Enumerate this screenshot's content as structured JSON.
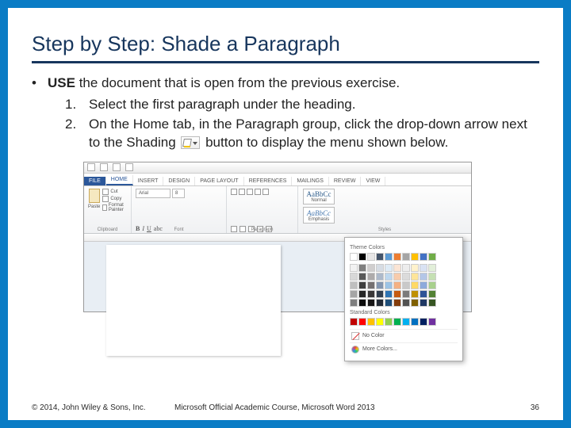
{
  "title": "Step by Step: Shade a Paragraph",
  "bullet": {
    "use_label": "USE",
    "use_rest": " the document that is open from the previous exercise.",
    "steps": [
      {
        "num": "1.",
        "text": "Select the first paragraph under the heading."
      },
      {
        "num": "2.",
        "text_a": "On the Home tab, in the Paragraph group, click the drop-down arrow next to the Shading ",
        "text_b": " button to display the menu shown below."
      }
    ]
  },
  "ribbon": {
    "tabs": {
      "file": "FILE",
      "home": "HOME",
      "insert": "INSERT",
      "design": "DESIGN",
      "pagelayout": "PAGE LAYOUT",
      "references": "REFERENCES",
      "mailings": "MAILINGS",
      "review": "REVIEW",
      "view": "VIEW"
    },
    "clipboard": {
      "paste": "Paste",
      "cut": "Cut",
      "copy": "Copy",
      "painter": "Format Painter",
      "label": "Clipboard"
    },
    "font": {
      "name": "Arial",
      "size": "8",
      "label": "Font"
    },
    "paragraph": {
      "label": "Paragraph"
    },
    "styles": {
      "normal_prev": "AaBbCc",
      "normal": "Normal",
      "emph_prev": "AaBbCc",
      "emph": "Emphasis",
      "label": "Styles"
    }
  },
  "dropdown": {
    "theme_label": "Theme Colors",
    "theme_top": [
      "#ffffff",
      "#000000",
      "#e7e6e6",
      "#44546a",
      "#5b9bd5",
      "#ed7d31",
      "#a5a5a5",
      "#ffc000",
      "#4472c4",
      "#70ad47"
    ],
    "theme_shades": [
      [
        "#f2f2f2",
        "#7f7f7f",
        "#d0cece",
        "#d6dce4",
        "#deebf6",
        "#fbe5d5",
        "#ededed",
        "#fff2cc",
        "#d9e2f3",
        "#e2efd9"
      ],
      [
        "#d8d8d8",
        "#595959",
        "#aeabab",
        "#adb9ca",
        "#bdd7ee",
        "#f7cbac",
        "#dbdbdb",
        "#fee599",
        "#b4c6e7",
        "#c5e0b3"
      ],
      [
        "#bfbfbf",
        "#3f3f3f",
        "#757070",
        "#8496b0",
        "#9cc3e5",
        "#f4b183",
        "#c9c9c9",
        "#ffd965",
        "#8eaadb",
        "#a8d08d"
      ],
      [
        "#a5a5a5",
        "#262626",
        "#3a3838",
        "#323f4f",
        "#2e75b5",
        "#c55a11",
        "#7b7b7b",
        "#bf9000",
        "#2f5496",
        "#538135"
      ],
      [
        "#7f7f7f",
        "#0c0c0c",
        "#171616",
        "#222a35",
        "#1e4e79",
        "#833c0b",
        "#525252",
        "#7f6000",
        "#1f3864",
        "#375623"
      ]
    ],
    "standard_label": "Standard Colors",
    "standard": [
      "#c00000",
      "#ff0000",
      "#ffc000",
      "#ffff00",
      "#92d050",
      "#00b050",
      "#00b0f0",
      "#0070c0",
      "#002060",
      "#7030a0"
    ],
    "no_color": "No Color",
    "more_colors": "More Colors..."
  },
  "footer": {
    "left": "© 2014, John Wiley & Sons, Inc.",
    "center": "Microsoft Official Academic Course, Microsoft Word 2013",
    "page": "36"
  }
}
